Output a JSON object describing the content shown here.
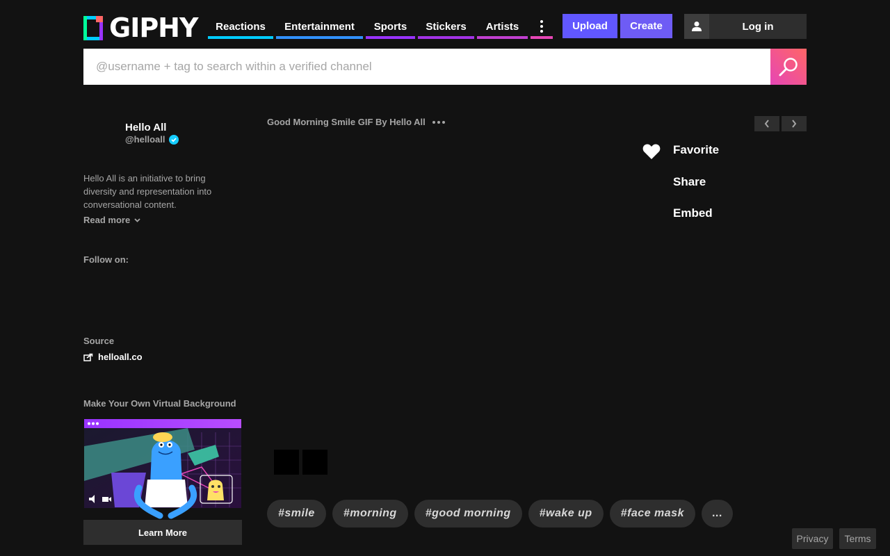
{
  "header": {
    "logo_text": "GIPHY",
    "nav": [
      {
        "label": "Reactions",
        "color": "#00ccff"
      },
      {
        "label": "Entertainment",
        "color": "#3191ff"
      },
      {
        "label": "Sports",
        "color": "#9933ff"
      },
      {
        "label": "Stickers",
        "color": "#9933ff"
      },
      {
        "label": "Artists",
        "color": "#e646b6"
      }
    ],
    "more_color": "#e646b6",
    "upload_label": "Upload",
    "create_label": "Create",
    "login_label": "Log in"
  },
  "search": {
    "placeholder": "@username + tag to search within a verified channel"
  },
  "channel": {
    "name": "Hello All",
    "handle": "@helloall",
    "bio": "Hello All is an initiative to bring diversity and representation into conversational content.",
    "read_more": "Read more",
    "follow_on_label": "Follow on:",
    "source_label": "Source",
    "source_link": "helloall.co",
    "virtual_bg_title": "Make Your Own Virtual Background",
    "learn_more_label": "Learn More"
  },
  "gif": {
    "title": "Good Morning Smile GIF By Hello All"
  },
  "actions": {
    "favorite": "Favorite",
    "share": "Share",
    "embed": "Embed"
  },
  "tags": [
    "#smile",
    "#morning",
    "#good morning",
    "#wake up",
    "#face mask"
  ],
  "tags_more": "...",
  "footer": {
    "privacy": "Privacy",
    "terms": "Terms"
  }
}
